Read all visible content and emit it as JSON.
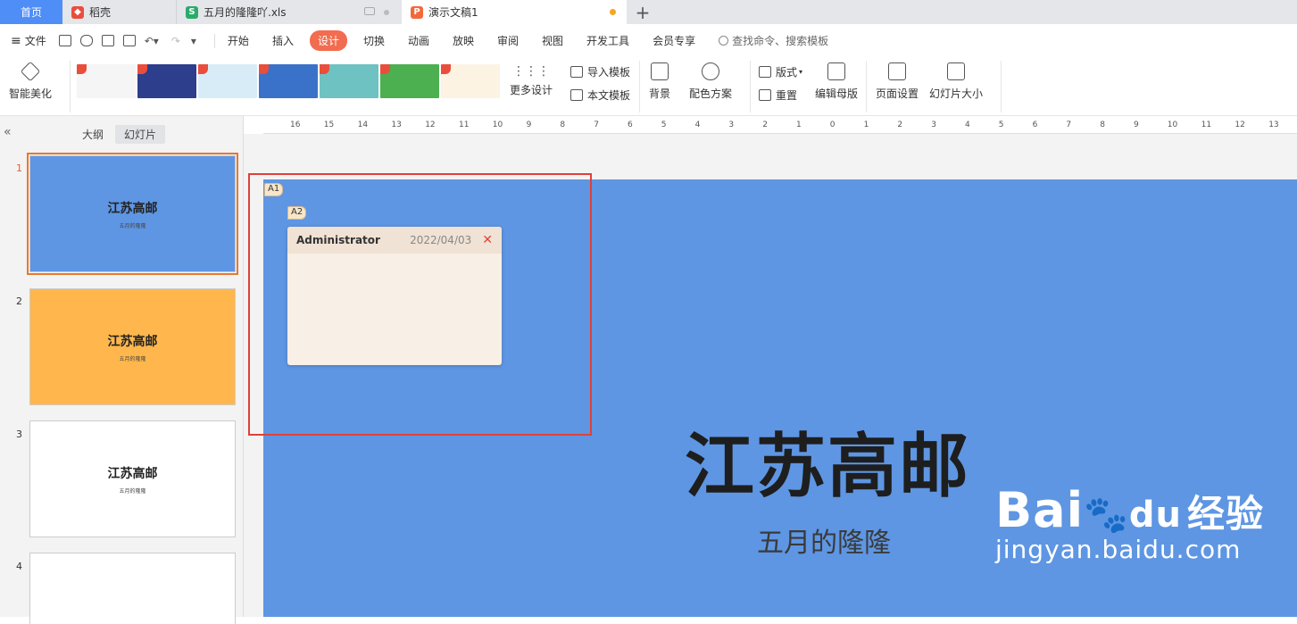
{
  "tabs": [
    {
      "label": "首页"
    },
    {
      "label": "稻壳"
    },
    {
      "label": "五月的隆隆吖.xls"
    },
    {
      "label": "演示文稿1"
    }
  ],
  "menu": {
    "file": "文件",
    "items": [
      "开始",
      "插入",
      "设计",
      "切换",
      "动画",
      "放映",
      "审阅",
      "视图",
      "开发工具",
      "会员专享"
    ],
    "search_placeholder": "查找命令、搜索模板"
  },
  "ribbon": {
    "smart": "智能美化",
    "more_design": "更多设计",
    "import_template": "导入模板",
    "this_template": "本文模板",
    "background": "背景",
    "color_scheme": "配色方案",
    "layout": "版式",
    "reset": "重置",
    "edit_master": "编辑母版",
    "page_setup": "页面设置",
    "slide_size": "幻灯片大小"
  },
  "template_thumbs": [
    "#f5f5f5",
    "#2c3e8c",
    "#d8ecf7",
    "#3a72c9",
    "#6fc2c2",
    "#4caf50",
    "#fdf3e3"
  ],
  "panel": {
    "outline": "大纲",
    "slides": "幻灯片"
  },
  "slides": [
    {
      "num": "1",
      "title": "江苏高邮",
      "subtitle": "五月的隆隆",
      "bg": "#5e96e3"
    },
    {
      "num": "2",
      "title": "江苏高邮",
      "subtitle": "五月的隆隆",
      "bg": "#ffb74d"
    },
    {
      "num": "3",
      "title": "江苏高邮",
      "subtitle": "五月的隆隆",
      "bg": "#ffffff"
    },
    {
      "num": "4",
      "title": "",
      "subtitle": "",
      "bg": "#ffffff"
    }
  ],
  "ruler_ticks": [
    "16",
    "15",
    "14",
    "13",
    "12",
    "11",
    "10",
    "9",
    "8",
    "7",
    "6",
    "5",
    "4",
    "3",
    "2",
    "1",
    "0",
    "1",
    "2",
    "3",
    "4",
    "5",
    "6",
    "7",
    "8",
    "9",
    "10",
    "11",
    "12",
    "13"
  ],
  "main_slide": {
    "title": "江苏高邮",
    "subtitle": "五月的隆隆",
    "bg": "#5e96e3"
  },
  "comment_markers": [
    "A1",
    "A2"
  ],
  "comment": {
    "author": "Administrator",
    "date": "2022/04/03"
  },
  "watermark": {
    "logo_text": "Bai",
    "logo_du": "du",
    "logo_cn": "经验",
    "url": "jingyan.baidu.com"
  }
}
